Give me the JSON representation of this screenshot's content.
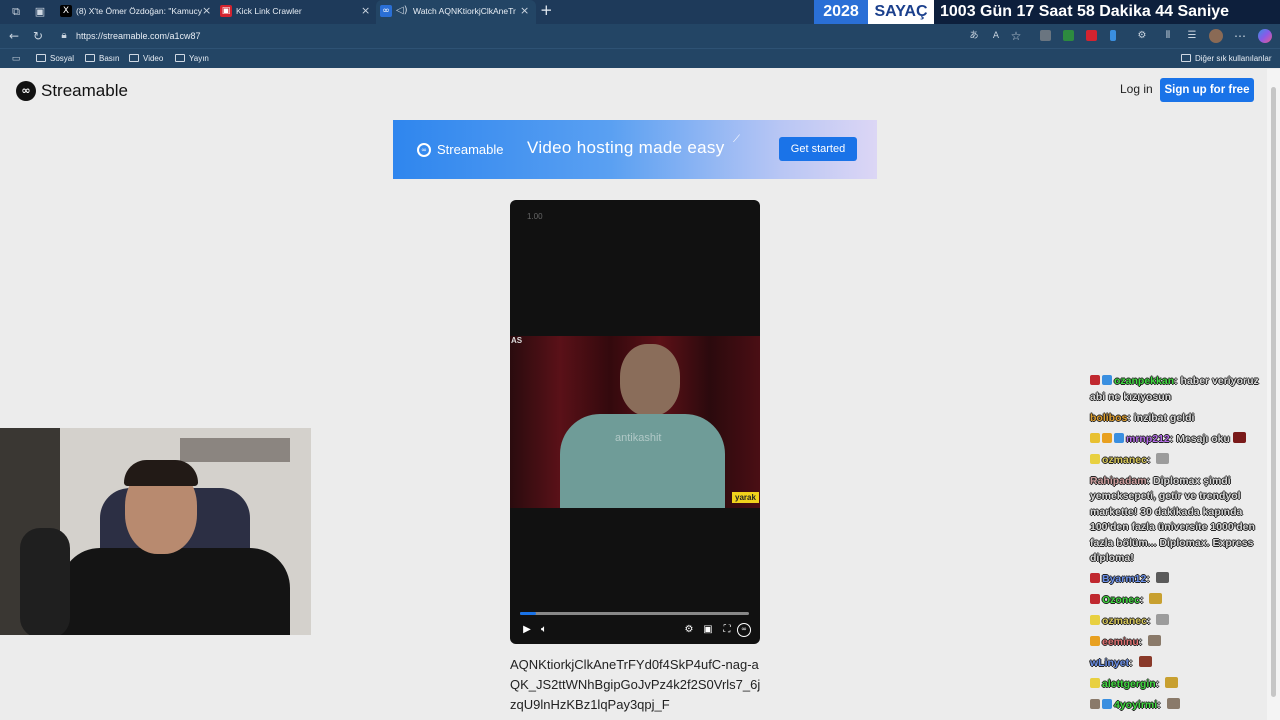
{
  "browser": {
    "tabs": [
      {
        "title": "(8) X'te Ömer Özdoğan: \"Kamucy",
        "favicon": "x-logo-icon"
      },
      {
        "title": "Kick Link Crawler",
        "favicon": "kick-crawler-icon"
      },
      {
        "title": "Watch AQNKtiorkjClkAneTr",
        "favicon": "streamable-icon",
        "active": true
      }
    ],
    "url": "https://streamable.com/a1cw87",
    "bookmarks": [
      "Sosyal",
      "Basın",
      "Video",
      "Yayın"
    ],
    "other_bookmarks": "Diğer sık kullanılanlar"
  },
  "countdown": {
    "year": "2028",
    "label": "SAYAÇ",
    "text": "1003 Gün  17 Saat  58 Dakika  44 Saniye"
  },
  "site": {
    "brand": "Streamable",
    "login": "Log in",
    "signup": "Sign up for free",
    "banner": {
      "brand": "Streamable",
      "tagline": "Video hosting made easy",
      "cta": "Get started"
    }
  },
  "player": {
    "speed": "1.00",
    "watermark": "antikashit",
    "caption": "yarak",
    "corner_mark": "AS",
    "progress": 0.07
  },
  "video_title": "AQNKtiorkjClkAneTrFYd0f4SkP4ufC-nag-aQK_JS2ttWNhBgipGoJvPz4k2f2S0Vrls7_6jzqU9lnHzKBz1lqPay3qpj_F",
  "chat": [
    {
      "user": "ozanpekkan",
      "text": "haber veriyoruz abi ne kızıyosun",
      "color": "#3fd83f",
      "badges": [
        "#c0282f",
        "#3a8fe0"
      ]
    },
    {
      "user": "bolibos",
      "text": "inzibat geldi",
      "color": "#e0a030",
      "badges": []
    },
    {
      "user": "mrnp212",
      "text": "Mesajı oku",
      "color": "#b46ee8",
      "badges": [
        "#e8c030",
        "#e8a020",
        "#3a8fe0"
      ],
      "emote": "#7a1a1a"
    },
    {
      "user": "ozmanec",
      "text": "",
      "color": "#d8c85a",
      "badges": [
        "#e8d040"
      ],
      "emote": "#9c9c9c"
    },
    {
      "user": "Rahipadam",
      "text": "Diplomax şimdi yemeksepeti, getir ve trendyol markette! 30 dakikada kapında 100'den fazla üniversite 1000'den fazla bölüm... Diplomax. Express diploma!",
      "color": "#d0a0a0",
      "badges": []
    },
    {
      "user": "Byarm12",
      "text": "",
      "color": "#6a8fe8",
      "badges": [
        "#c0282f"
      ],
      "emote": "#5a5a5a"
    },
    {
      "user": "Ozonec",
      "text": "",
      "color": "#3fd83f",
      "badges": [
        "#c0282f"
      ],
      "emote": "#c8a030"
    },
    {
      "user": "ozmanec",
      "text": "",
      "color": "#d8c85a",
      "badges": [
        "#e8d040"
      ],
      "emote": "#9c9c9c"
    },
    {
      "user": "eeminu",
      "text": "",
      "color": "#e07070",
      "badges": [
        "#e8a020"
      ],
      "emote": "#8a7a6a"
    },
    {
      "user": "wLinyet",
      "text": "",
      "color": "#6a8fe8",
      "badges": [],
      "emote": "#8a3a2a"
    },
    {
      "user": "alettgergin",
      "text": "",
      "color": "#3fd83f",
      "badges": [
        "#e8d040"
      ],
      "emote": "#c8a030"
    },
    {
      "user": "4yoyirmi",
      "text": "",
      "color": "#3fd83f",
      "badges": [
        "#8a7a6a",
        "#3a8fe0"
      ],
      "emote": "#8a7a6a"
    }
  ]
}
